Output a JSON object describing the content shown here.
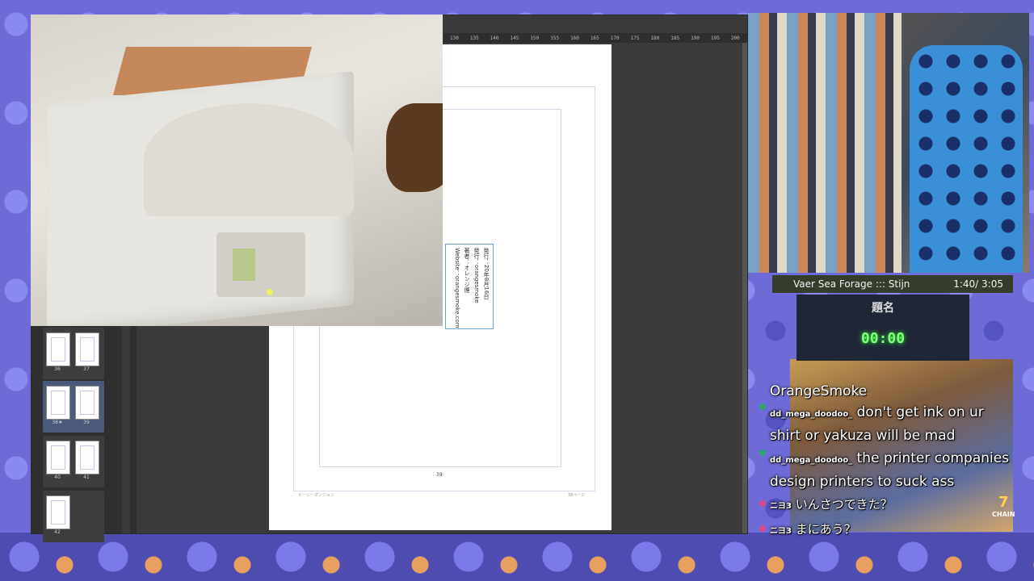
{
  "colors": {
    "accent": "#6e6bd6",
    "timer_green": "#7fff7a",
    "badge_green": "#2ea86a",
    "badge_pink": "#d84a8a"
  },
  "app": {
    "ruler_ticks": [
      "130",
      "135",
      "140",
      "145",
      "150",
      "155",
      "160",
      "165",
      "170",
      "175",
      "180",
      "185",
      "190",
      "195",
      "200",
      "205",
      "210",
      "215",
      "220",
      "225",
      "230"
    ],
    "pages": [
      {
        "labels": [
          "36",
          "37"
        ]
      },
      {
        "labels": [
          "38★",
          "39"
        ]
      },
      {
        "labels": [
          "40",
          "41"
        ]
      },
      {
        "labels": [
          "42"
        ]
      }
    ],
    "canvas": {
      "page_number": "38",
      "footer_left": "ドーシーダンジョン",
      "footer_right": "38ページ",
      "imprint_lines": [
        "発行：20年8月16日",
        "発行：orangesmoke",
        "著者：オレンジ煙",
        "Website：orangesmoke.com"
      ]
    }
  },
  "now_playing": {
    "title": "Vaer Sea Forage  :::  Stijn",
    "time": "1:40/ 3:05"
  },
  "timer": {
    "title": "題名",
    "value": "00:00"
  },
  "game": {
    "chain_label": "CHAIN",
    "chain_count": "7"
  },
  "chat": {
    "header": "OrangeSmoke",
    "messages": [
      {
        "user": "dd_mega_doodoo_",
        "text": "don't get ink on ur shirt or yakuza will be mad",
        "badge": "green"
      },
      {
        "user": "dd_mega_doodoo_",
        "text": "the printer companies design printers to suck ass",
        "badge": "green"
      },
      {
        "user": "ニヨ3",
        "text": "いんさつできた？",
        "badge": "pink"
      },
      {
        "user": "ニヨ3",
        "text": "まにあう？",
        "badge": "pink"
      }
    ]
  }
}
